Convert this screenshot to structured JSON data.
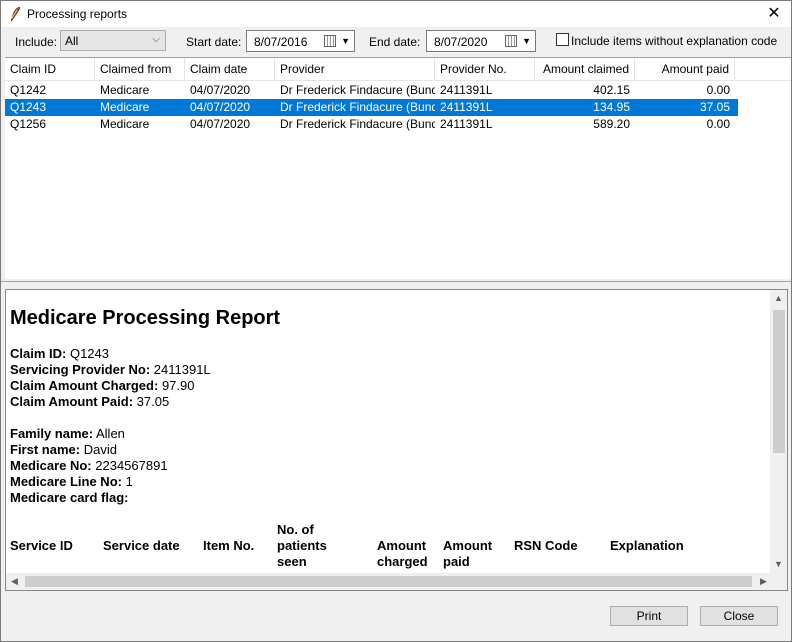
{
  "window": {
    "title": "Processing reports",
    "close_glyph": "✕"
  },
  "filters": {
    "include_label": "Include:",
    "include_value": "All",
    "start_label": "Start date:",
    "start_value": "8/07/2016",
    "end_label": "End date:",
    "end_value": "8/07/2020",
    "checkbox_label": "Include items without explanation code",
    "checkbox_checked": false
  },
  "grid": {
    "columns": [
      "Claim ID",
      "Claimed from",
      "Claim date",
      "Provider",
      "Provider No.",
      "Amount claimed",
      "Amount paid"
    ],
    "rows": [
      [
        "Q1242",
        "Medicare",
        "04/07/2020",
        "Dr Frederick Findacure (Bund...",
        "2411391L",
        "402.15",
        "0.00"
      ],
      [
        "Q1243",
        "Medicare",
        "04/07/2020",
        "Dr Frederick Findacure (Bund...",
        "2411391L",
        "134.95",
        "37.05"
      ],
      [
        "Q1256",
        "Medicare",
        "04/07/2020",
        "Dr Frederick Findacure (Bund...",
        "2411391L",
        "589.20",
        "0.00"
      ]
    ],
    "selected_row": 1
  },
  "report": {
    "title": "Medicare Processing Report",
    "claim_id_label": "Claim ID:",
    "claim_id": "Q1243",
    "provider_no_label": "Servicing Provider No:",
    "provider_no": "2411391L",
    "charged_label": "Claim Amount Charged:",
    "charged": "97.90",
    "paid_label": "Claim Amount Paid:",
    "paid": "37.05",
    "family_label": "Family name:",
    "family": "Allen",
    "first_label": "First name:",
    "first": "David",
    "medicare_no_label": "Medicare No:",
    "medicare_no": "2234567891",
    "line_no_label": "Medicare Line No:",
    "line_no": "1",
    "card_flag_label": "Medicare card flag:",
    "card_flag": "",
    "table_headers": {
      "service_id": "Service ID",
      "service_date": "Service date",
      "item_no": "Item No.",
      "patients_1": "No. of",
      "patients_2": "patients",
      "patients_3": "seen",
      "charged_1": "Amount",
      "charged_2": "charged",
      "paid_1": "Amount",
      "paid_2": "paid",
      "rsn": "RSN Code",
      "explanation": "Explanation"
    }
  },
  "buttons": {
    "print": "Print",
    "close": "Close"
  }
}
